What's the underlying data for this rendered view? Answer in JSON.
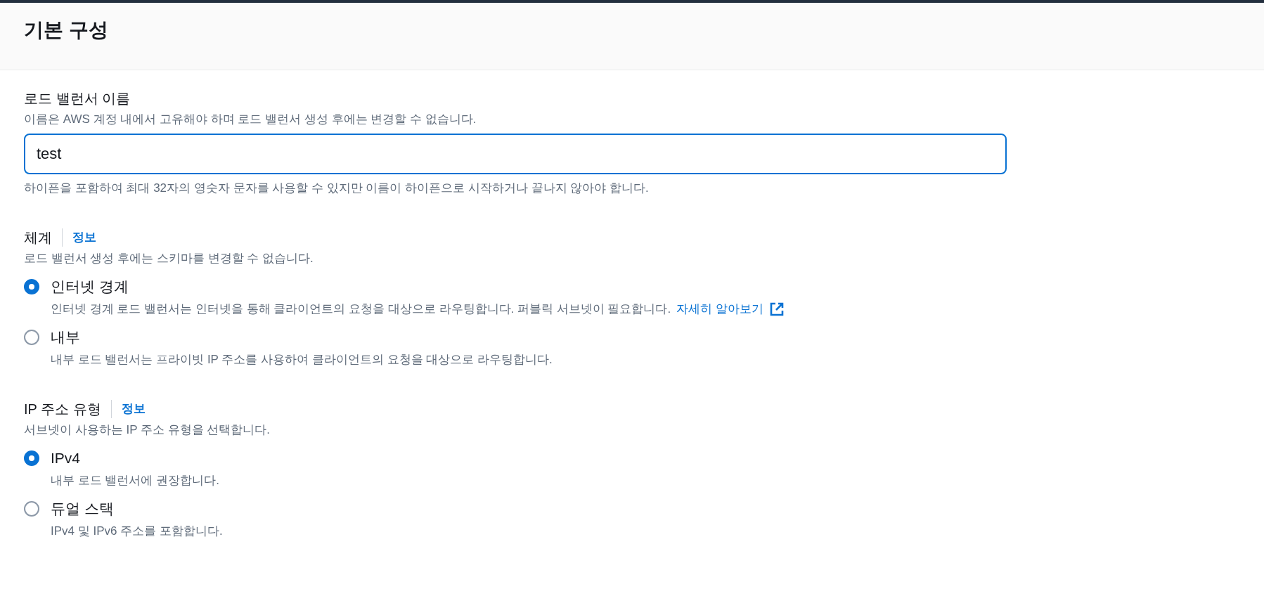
{
  "header": {
    "title": "기본 구성"
  },
  "name_field": {
    "label": "로드 밸런서 이름",
    "description": "이름은 AWS 계정 내에서 고유해야 하며 로드 밸런서 생성 후에는 변경할 수 없습니다.",
    "value": "test",
    "constraint": "하이픈을 포함하여 최대 32자의 영숫자 문자를 사용할 수 있지만 이름이 하이픈으로 시작하거나 끝나지 않아야 합니다."
  },
  "groups": [
    {
      "label": "체계",
      "info_link": "정보",
      "description": "로드 밸런서 생성 후에는 스키마를 변경할 수 없습니다.",
      "options": [
        {
          "label": "인터넷 경계",
          "description": "인터넷 경계 로드 밸런서는 인터넷을 통해 클라이언트의 요청을 대상으로 라우팅합니다. 퍼블릭 서브넷이 필요합니다.",
          "link": "자세히 알아보기",
          "selected": true
        },
        {
          "label": "내부",
          "description": "내부 로드 밸런서는 프라이빗 IP 주소를 사용하여 클라이언트의 요청을 대상으로 라우팅합니다.",
          "selected": false
        }
      ]
    },
    {
      "label": "IP 주소 유형",
      "info_link": "정보",
      "description": "서브넷이 사용하는 IP 주소 유형을 선택합니다.",
      "options": [
        {
          "label": "IPv4",
          "description": "내부 로드 밸런서에 권장합니다.",
          "selected": true
        },
        {
          "label": "듀얼 스택",
          "description": "IPv4 및 IPv6 주소를 포함합니다.",
          "selected": false
        }
      ]
    }
  ]
}
